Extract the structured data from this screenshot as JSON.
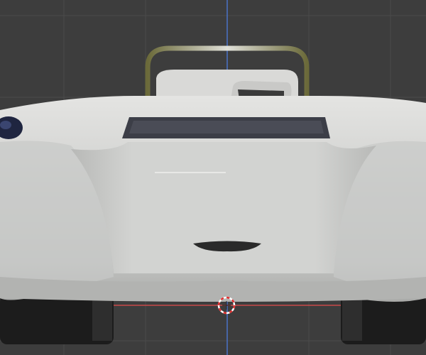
{
  "viewport": {
    "mode": "3d-viewport-front-ortho",
    "colors": {
      "background": "#3d3d3d",
      "grid": "#4a4a4a",
      "axis_z": "#4a73c8",
      "axis_x": "#c84a4a",
      "body": "#d6d6d4",
      "cockpit": "#3c3e47",
      "tire": "#1c1c1c",
      "cursor_red": "#e03030"
    },
    "icons": [
      "3d-cursor-icon"
    ]
  }
}
